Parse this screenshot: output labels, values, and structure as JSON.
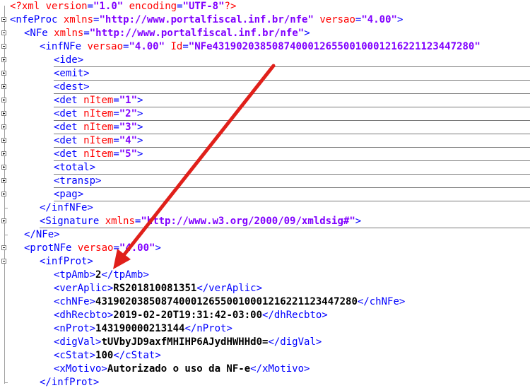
{
  "xml_decl": {
    "open": "<?xml",
    "attr1": "version",
    "val1": "\"1.0\"",
    "attr2": "encoding",
    "val2": "\"UTF-8\"",
    "close": "?>"
  },
  "nfeProc": {
    "open": "<nfeProc",
    "attr1": "xmlns",
    "val1": "\"http://www.portalfiscal.inf.br/nfe\"",
    "attr2": "versao",
    "val2": "\"4.00\"",
    "close": ">"
  },
  "nfe": {
    "open": "<NFe",
    "attr1": "xmlns",
    "val1": "\"http://www.portalfiscal.inf.br/nfe\"",
    "close": ">"
  },
  "infNFe": {
    "open": "<infNFe",
    "attr1": "versao",
    "val1": "\"4.00\"",
    "attr2": "Id",
    "val2": "\"NFe43190203850874000126550010001216221123447280\""
  },
  "collapsed": [
    "<ide>",
    "<emit>",
    "<dest>"
  ],
  "det": {
    "tag": "<det",
    "attr": "nItem",
    "items": [
      "\"1\"",
      "\"2\"",
      "\"3\"",
      "\"4\"",
      "\"5\""
    ],
    "close": ">"
  },
  "collapsed2": [
    "<total>",
    "<transp>",
    "<pag>"
  ],
  "infNFe_close": "</infNFe>",
  "signature": {
    "open": "<Signature",
    "attr": "xmlns",
    "val": "\"http://www.w3.org/2000/09/xmldsig#\"",
    "close": ">"
  },
  "nfe_close": "</NFe>",
  "protNFe": {
    "open": "<protNFe",
    "attr": "versao",
    "val": "\"4.00\"",
    "close": ">"
  },
  "infProt_open": "<infProt>",
  "prot_fields": [
    {
      "open": "<tpAmb>",
      "value": "2",
      "close": "</tpAmb>"
    },
    {
      "open": "<verAplic>",
      "value": "RS201810081351",
      "close": "</verAplic>"
    },
    {
      "open": "<chNFe>",
      "value": "43190203850874000126550010001216221123447280",
      "close": "</chNFe>"
    },
    {
      "open": "<dhRecbto>",
      "value": "2019-02-20T19:31:42-03:00",
      "close": "</dhRecbto>"
    },
    {
      "open": "<nProt>",
      "value": "143190000213144",
      "close": "</nProt>"
    },
    {
      "open": "<digVal>",
      "value": "tUVbyJD9axfMHIHP6AJydHWHHd0=",
      "close": "</digVal>"
    },
    {
      "open": "<cStat>",
      "value": "100",
      "close": "</cStat>"
    },
    {
      "open": "<xMotivo>",
      "value": "Autorizado o uso da NF-e",
      "close": "</xMotivo>"
    }
  ],
  "infProt_close": "</infProt>",
  "colors": {
    "tag": "#0000ff",
    "attr": "#ff0000",
    "value": "#8000ff",
    "arrow": "#e0201a"
  }
}
